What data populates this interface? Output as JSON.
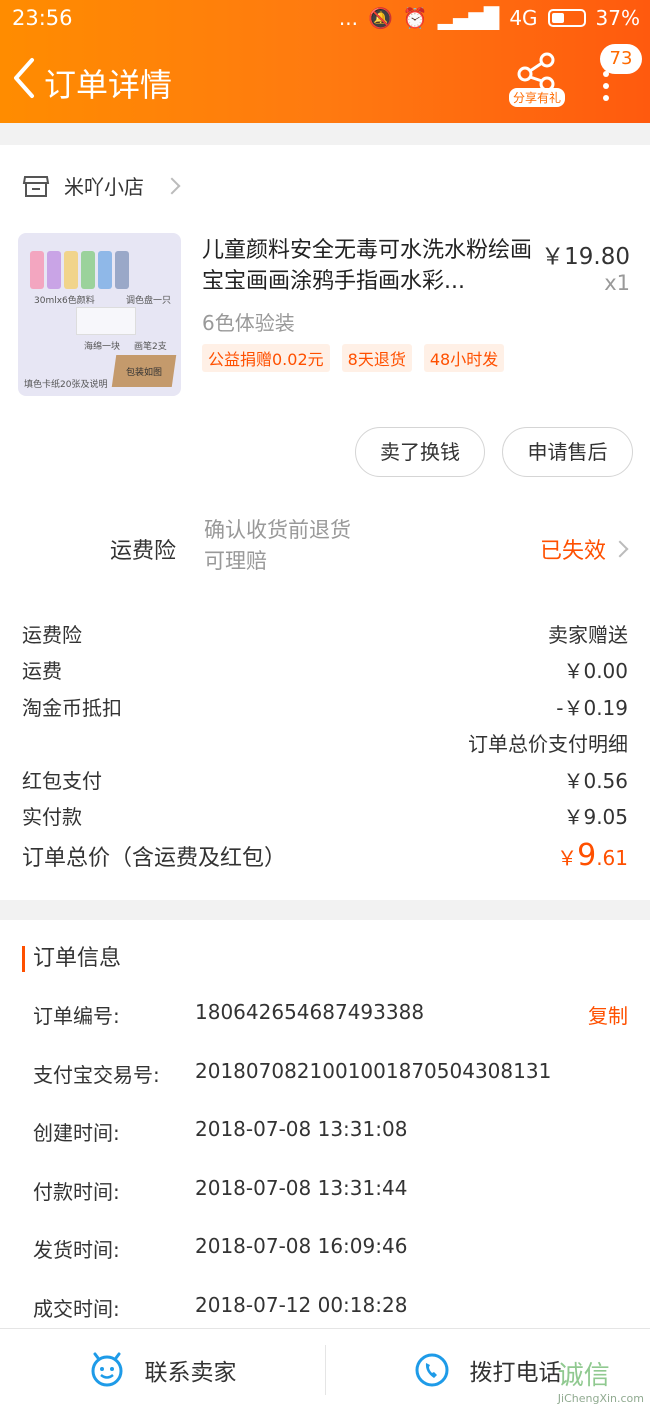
{
  "status_bar": {
    "time": "23:56",
    "dots": "...",
    "network": "4G",
    "battery": "37%"
  },
  "header": {
    "title": "订单详情",
    "share_label": "分享有礼",
    "badge_count": "73"
  },
  "shop": {
    "name": "米吖小店"
  },
  "product": {
    "title": "儿童颜料安全无毒可水洗水粉绘画宝宝画画涂鸦手指画水彩...",
    "price": "￥19.80",
    "qty": "x1",
    "sku": "6色体验装",
    "tags": [
      "公益捐赠0.02元",
      "8天退货",
      "48小时发"
    ],
    "image_captions": [
      "30mlx6色颜料",
      "调色盘一只",
      "海绵一块",
      "画笔2支",
      "填色卡纸20张及说明",
      "包装如图"
    ]
  },
  "actions": {
    "sell_label": "卖了换钱",
    "after_sale_label": "申请售后"
  },
  "insurance": {
    "label": "运费险",
    "desc_line1": "确认收货前退货",
    "desc_line2": "可理赔",
    "status": "已失效"
  },
  "fees": {
    "rows": [
      {
        "label": "运费险",
        "value": "卖家赠送"
      },
      {
        "label": "运费",
        "value": "￥0.00"
      },
      {
        "label": "淘金币抵扣",
        "value": "-￥0.19"
      }
    ],
    "detail_link": "订单总价支付明细",
    "rows2": [
      {
        "label": "红包支付",
        "value": "￥0.56"
      },
      {
        "label": "实付款",
        "value": "￥9.05"
      }
    ],
    "total_label": "订单总价（含运费及红包）",
    "total_currency": "￥",
    "total_int": "9",
    "total_dec": ".61"
  },
  "order_info": {
    "title": "订单信息",
    "copy_label": "复制",
    "rows": [
      {
        "key": "订单编号:",
        "value": "180642654687493388"
      },
      {
        "key": "支付宝交易号:",
        "value": "2018070821001001870504308131"
      },
      {
        "key": "创建时间:",
        "value": "2018-07-08 13:31:08"
      },
      {
        "key": "付款时间:",
        "value": "2018-07-08 13:31:44"
      },
      {
        "key": "发货时间:",
        "value": "2018-07-08 16:09:46"
      },
      {
        "key": "成交时间:",
        "value": "2018-07-12 00:18:28"
      }
    ]
  },
  "bottom": {
    "contact_label": "联系卖家",
    "call_label": "拨打电话"
  },
  "watermark": {
    "text": "诚信",
    "sub": "JiChengXin.com"
  },
  "colors": {
    "accent": "#ff5000",
    "header_start": "#ff8c00",
    "header_end": "#ff5a0e"
  }
}
